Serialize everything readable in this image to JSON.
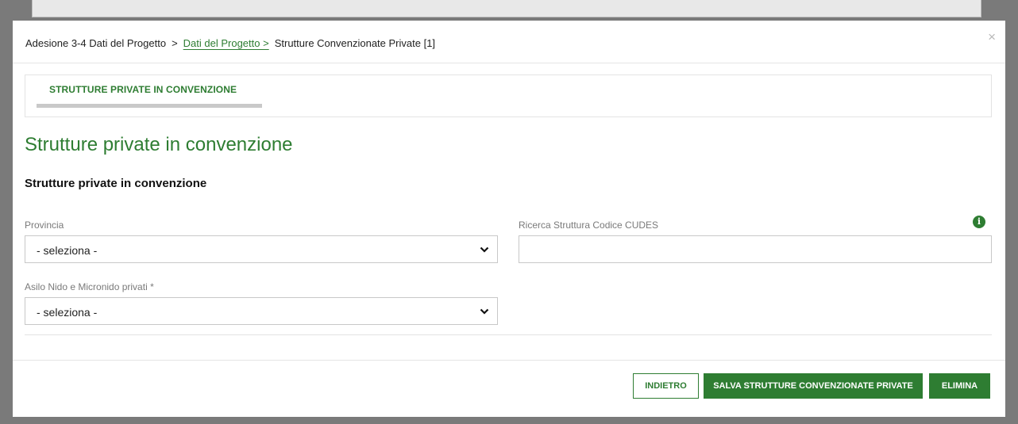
{
  "breadcrumb": {
    "item1": "Adesione 3-4 Dati del Progetto",
    "sep": ">",
    "item2": "Dati del Progetto >",
    "item3": "Strutture Convenzionate Private [1]"
  },
  "close_label": "×",
  "tabs": [
    {
      "label": "STRUTTURE PRIVATE IN CONVENZIONE"
    }
  ],
  "page_title": "Strutture private in convenzione",
  "section_title": "Strutture private in convenzione",
  "fields": {
    "provincia": {
      "label": "Provincia",
      "value": "- seleziona -"
    },
    "cudes": {
      "label": "Ricerca Struttura Codice CUDES",
      "value": ""
    },
    "asilo": {
      "label": "Asilo Nido e Micronido privati *",
      "value": "- seleziona -"
    }
  },
  "info_icon_glyph": "i",
  "footer": {
    "back_label": "INDIETRO",
    "save_label": "SALVA STRUTTURE CONVENZIONATE PRIVATE",
    "delete_label": "ELIMINA"
  },
  "colors": {
    "accent": "#2e7d32",
    "overlay": "#7a7a7a"
  }
}
